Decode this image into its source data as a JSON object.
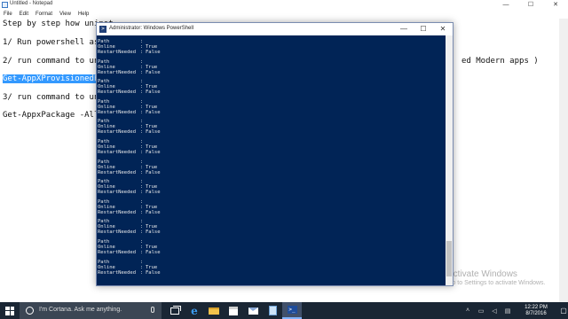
{
  "notepad": {
    "title": "Untitled - Notepad",
    "menu": [
      "File",
      "Edit",
      "Format",
      "View",
      "Help"
    ],
    "lines": [
      {
        "text": "Step by step how uninst"
      },
      {
        "text": "1/ Run powershell as ac"
      },
      {
        "text": "2/ run command to unins"
      },
      {
        "text": "ed Modern apps )"
      },
      {
        "text": "Get-AppXProvisionedPac"
      },
      {
        "text": "3/ run command to unins"
      },
      {
        "text": "Get-AppxPackage -AllUse"
      }
    ]
  },
  "powershell": {
    "title": "Administrator: Windows PowerShell",
    "entries": [
      {
        "path": "",
        "online": "True",
        "restart": "False"
      },
      {
        "path": "",
        "online": "True",
        "restart": "False"
      },
      {
        "path": "",
        "online": "True",
        "restart": "False"
      },
      {
        "path": "",
        "online": "True",
        "restart": "False"
      },
      {
        "path": "",
        "online": "True",
        "restart": "False"
      },
      {
        "path": "",
        "online": "True",
        "restart": "False"
      },
      {
        "path": "",
        "online": "True",
        "restart": "False"
      },
      {
        "path": "",
        "online": "True",
        "restart": "False"
      },
      {
        "path": "",
        "online": "True",
        "restart": "False"
      },
      {
        "path": "",
        "online": "True",
        "restart": "False"
      },
      {
        "path": "",
        "online": "True",
        "restart": "False"
      },
      {
        "path": "",
        "online": "True",
        "restart": "False"
      }
    ],
    "keys": {
      "path": "Path",
      "online": "Online",
      "restart": "RestartNeeded",
      "sep": ":"
    }
  },
  "watermark": {
    "line1": "Activate Windows",
    "line2": "Go to Settings to activate Windows."
  },
  "taskbar": {
    "search_placeholder": "I'm Cortana. Ask me anything.",
    "time": "12:22 PM",
    "date": "8/7/2016"
  },
  "colors": {
    "ps_background": "#012456",
    "taskbar": "#1a2634",
    "selection": "#3399ff"
  }
}
